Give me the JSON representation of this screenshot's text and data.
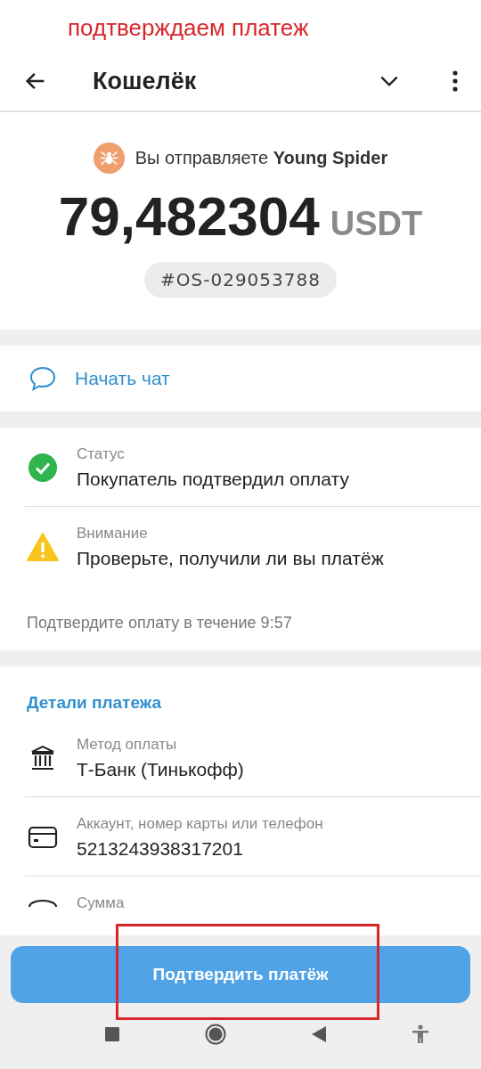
{
  "annotation": {
    "caption": "подтверждаем платеж"
  },
  "header": {
    "title": "Кошелёк"
  },
  "summary": {
    "prefix": "Вы отправляете",
    "recipient": "Young Spider",
    "amount": "79,482304",
    "currency": "USDT",
    "order_id": "#OS-029053788"
  },
  "chat": {
    "label": "Начать чат"
  },
  "status_items": [
    {
      "kind": "success",
      "label": "Статус",
      "value": "Покупатель подтвердил оплату"
    },
    {
      "kind": "warning",
      "label": "Внимание",
      "value": "Проверьте, получили ли вы платёж"
    }
  ],
  "timer_note": "Подтвердите оплату в течение 9:57",
  "details": {
    "title": "Детали платежа",
    "items": [
      {
        "kind": "bank",
        "label": "Метод оплаты",
        "value": "Т-Банк (Тинькофф)"
      },
      {
        "kind": "card",
        "label": "Аккаунт, номер карты или телефон",
        "value": "5213243938317201"
      },
      {
        "kind": "amount",
        "label": "Сумма"
      }
    ]
  },
  "confirm_button": {
    "label": "Подтвердить платёж",
    "highlighted": true
  }
}
